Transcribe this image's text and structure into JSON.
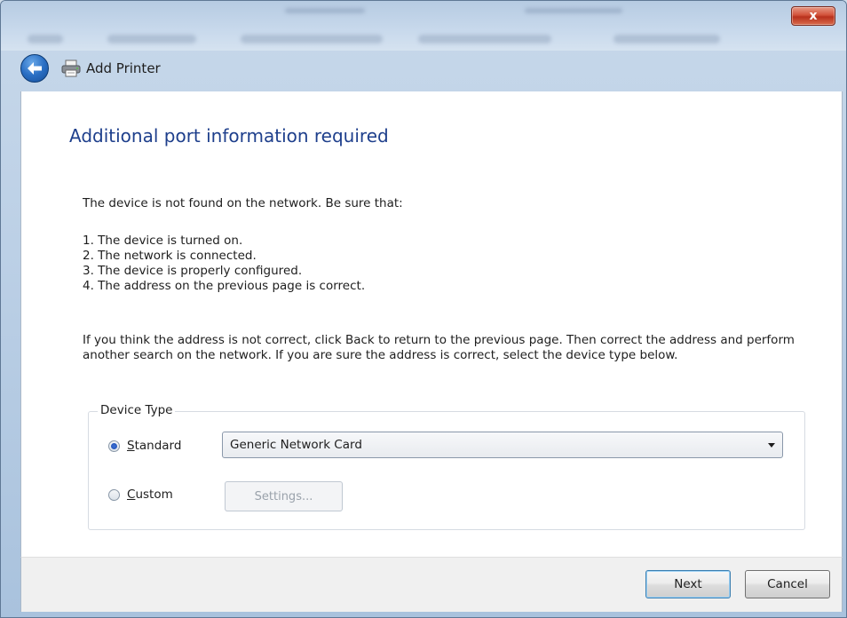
{
  "window": {
    "title": "Add Printer",
    "close_label": "x"
  },
  "page": {
    "heading": "Additional port information required",
    "intro": "The device is not found on the network.  Be sure that:",
    "steps": [
      "1.  The device is turned on.",
      "2.  The network is connected.",
      "3.  The device is properly configured.",
      "4.  The address on the previous page is correct."
    ],
    "paragraph": "If you think the address is not correct, click Back to return to the previous page.  Then correct the address and perform another search on the network.  If you are sure the address is correct, select the device type below."
  },
  "device_type": {
    "group_label": "Device Type",
    "standard": {
      "access_key": "S",
      "rest": "tandard",
      "selected": true
    },
    "custom": {
      "access_key": "C",
      "rest": "ustom",
      "selected": false
    },
    "selected_card": "Generic Network Card",
    "settings_label": "Settings..."
  },
  "footer": {
    "next_label": "Next",
    "cancel_label": "Cancel"
  },
  "colors": {
    "heading": "#1e3f8c",
    "close_button": "#c9432b",
    "radio_selected": "#1f4fb0"
  }
}
